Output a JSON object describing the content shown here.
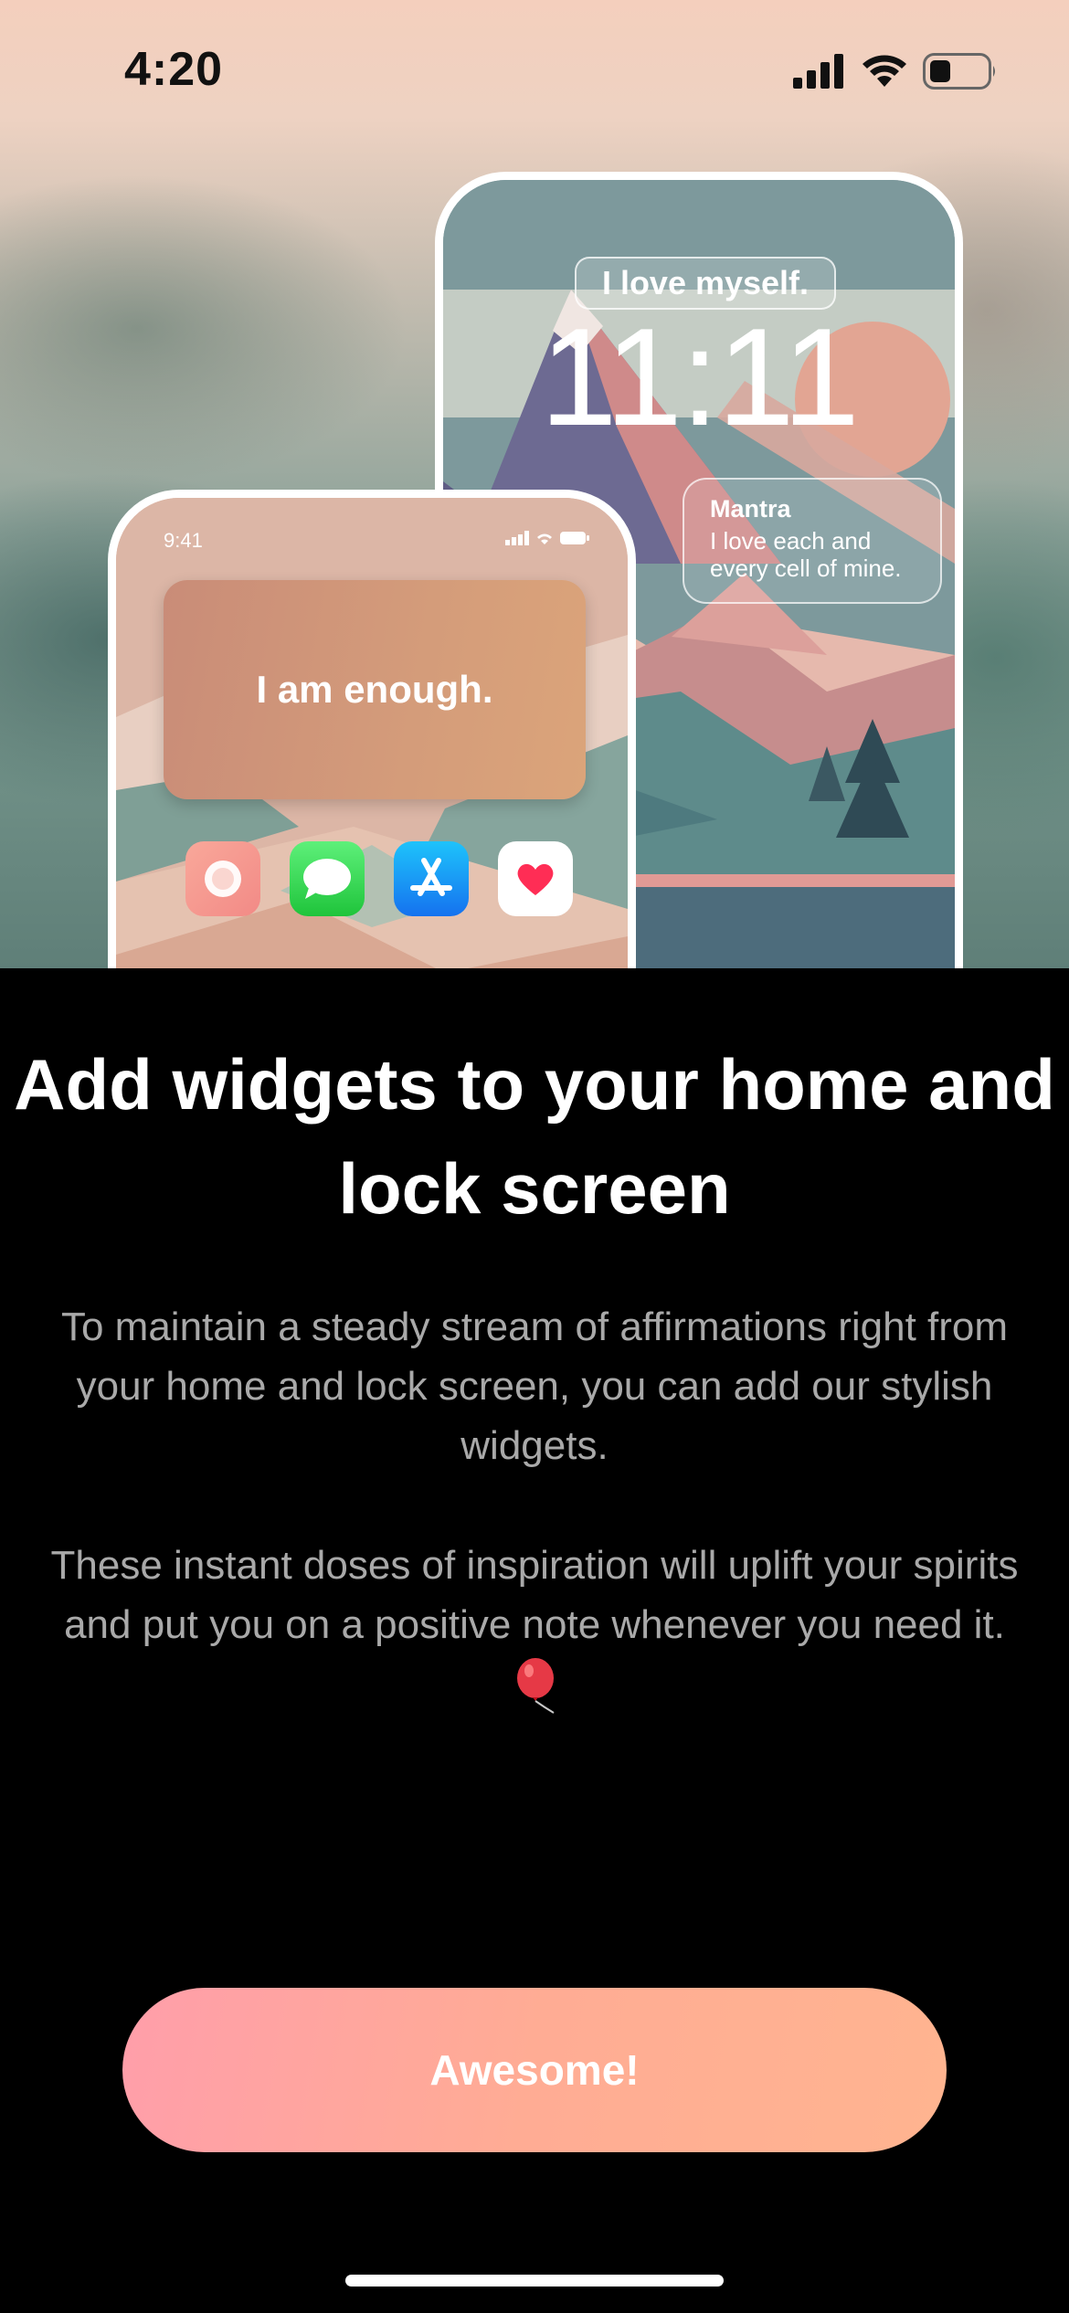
{
  "status_bar": {
    "time": "4:20"
  },
  "lock_screen_preview": {
    "quote": "I love myself.",
    "clock": "11:11",
    "mantra_title": "Mantra",
    "mantra_text": "I love each and every cell of mine."
  },
  "home_screen_preview": {
    "time": "9:41",
    "widget_text": "I am enough.",
    "apps": [
      "app-icon",
      "messages-icon",
      "app-store-icon",
      "health-icon"
    ]
  },
  "title": "Add widgets to your home and lock screen",
  "paragraphs": [
    "To maintain a steady stream of affirmations right from your home and lock screen, you can add our stylish widgets.",
    "These instant doses of inspiration will uplift your spirits and put you on a positive note whenever you need it."
  ],
  "button": {
    "label": "Awesome!"
  },
  "colors": {
    "button_gradient_start": "#ff9eaa",
    "button_gradient_end": "#ffb490",
    "background": "#000000",
    "body_text": "#a9a9a9"
  }
}
